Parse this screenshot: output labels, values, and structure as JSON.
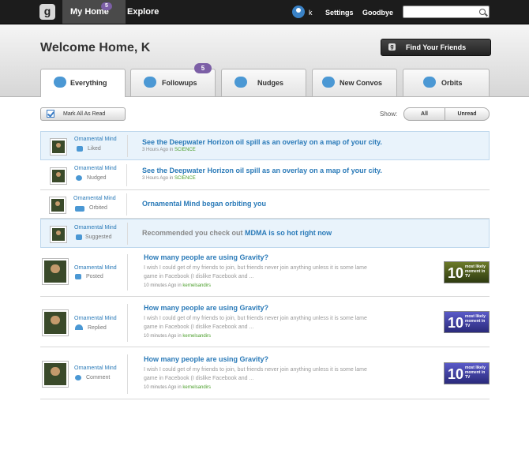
{
  "nav": {
    "logo": "g",
    "my_home": "My Home",
    "my_home_badge": "5",
    "explore": "Explore",
    "user": "k",
    "settings": "Settings",
    "goodbye": "Goodbye",
    "search_placeholder": ""
  },
  "header": {
    "welcome": "Welcome Home, K",
    "find_friends": "Find Your Friends"
  },
  "tabs": [
    {
      "label": "Everything",
      "active": true
    },
    {
      "label": "Followups",
      "badge": "5"
    },
    {
      "label": "Nudges"
    },
    {
      "label": "New Convos"
    },
    {
      "label": "Orbits"
    }
  ],
  "toolbar": {
    "mark_all": "Mark All As Read",
    "show": "Show:",
    "all": "All",
    "unread": "Unread"
  },
  "feed": [
    {
      "actor": "Ornamental Mind",
      "action": "Liked",
      "headline": "See the Deepwater Horizon oil spill as an overlay on a map of your city.",
      "time": "3 Hours Ago in ",
      "topic": "SCIENCE"
    },
    {
      "actor": "Ornamental Mind",
      "action": "Nudged",
      "headline": "See the Deepwater Horizon oil spill as an overlay on a map of your city.",
      "time": "3 Hours Ago in ",
      "topic": "SCIENCE"
    },
    {
      "actor": "Ornamental Mind",
      "action": "Orbited",
      "headline": "Ornamental Mind began orbiting you"
    },
    {
      "actor": "Ornamental Mind",
      "action": "Suggested",
      "headline_prefix": "Recommended you check out ",
      "headline_link": "MDMA is so hot right now"
    },
    {
      "actor": "Ornamental Mind",
      "action": "Posted",
      "headline": "How many people are using Gravity?",
      "excerpt": "I wish I could get of my friends to join, but friends never join anything unless it is some lame game in Facebook (I dislike Facebook and ...",
      "time": "10 minutes Ago in ",
      "topic": "kernelsandirs",
      "thumb": "10",
      "thumb_text": "most likely moment in TV"
    },
    {
      "actor": "Ornamental Mind",
      "action": "Replied",
      "headline": "How many people are using Gravity?",
      "excerpt": "I wish I could get of my friends to join, but friends never join anything unless it is some lame game in Facebook (I dislike Facebook and ...",
      "time": "10 minutes Ago in ",
      "topic": "kernelsandirs",
      "thumb": "10",
      "thumb_text": "most likely moment in TV"
    },
    {
      "actor": "Ornamental Mind",
      "action": "Comment",
      "headline": "How many people are using Gravity?",
      "excerpt": "I wish I could get of my friends to join, but friends never join anything unless it is some lame game in Facebook (I dislike Facebook and ...",
      "time": "10 minutes Ago in ",
      "topic": "kernelsandirs",
      "thumb": "10",
      "thumb_text": "most likely moment in TV"
    }
  ]
}
